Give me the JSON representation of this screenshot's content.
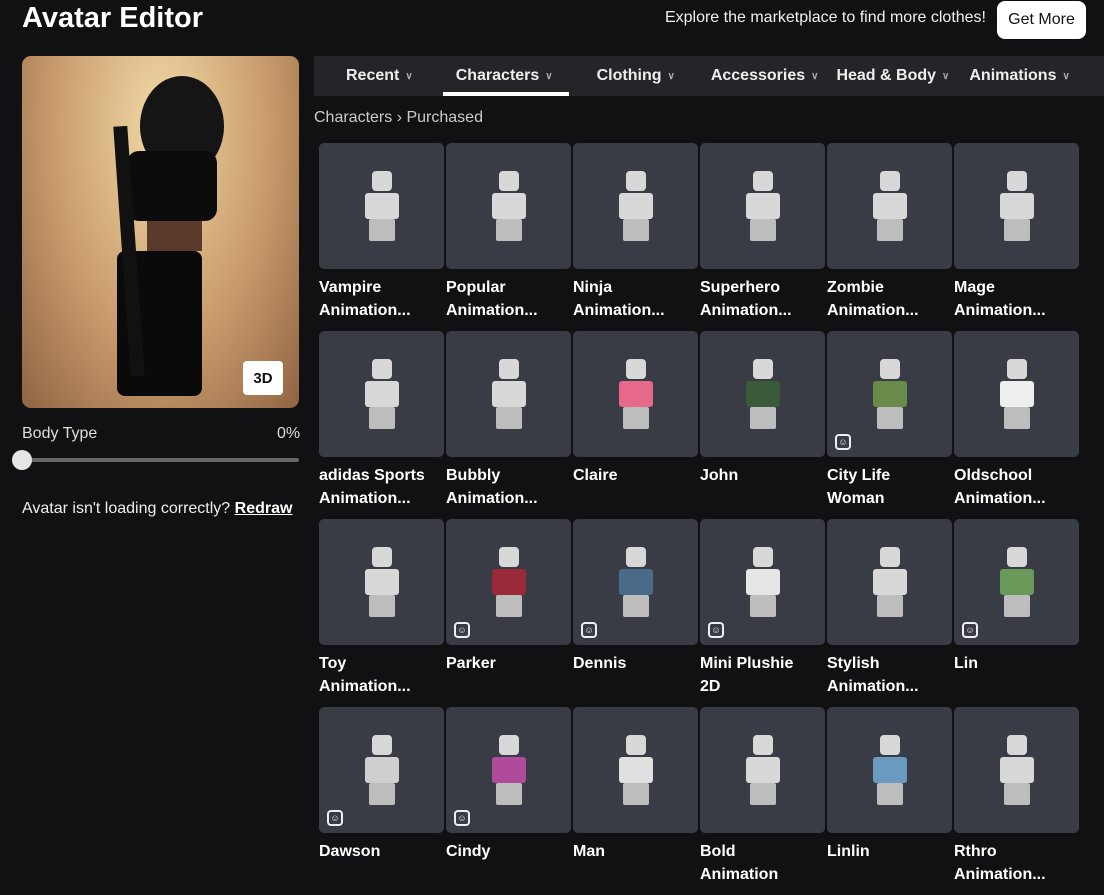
{
  "header": {
    "title": "Avatar Editor",
    "promo": "Explore the marketplace to find more clothes!",
    "get_more": "Get More"
  },
  "preview": {
    "view_toggle": "3D",
    "body_type_label": "Body Type",
    "body_type_value": "0%",
    "body_type_fraction": 0,
    "loading_text": "Avatar isn't loading correctly?",
    "redraw": "Redraw"
  },
  "nav": {
    "tabs": [
      {
        "label": "Recent"
      },
      {
        "label": "Characters",
        "active": true
      },
      {
        "label": "Clothing"
      },
      {
        "label": "Accessories"
      },
      {
        "label": "Head & Body"
      },
      {
        "label": "Animations"
      }
    ]
  },
  "breadcrumb": {
    "root": "Characters",
    "separator": "›",
    "current": "Purchased"
  },
  "items": [
    {
      "l1": "Vampire",
      "l2": "Animation...",
      "badge": false,
      "c": "#d8d8d8"
    },
    {
      "l1": "Popular",
      "l2": "Animation...",
      "badge": false,
      "c": "#d8d8d8"
    },
    {
      "l1": "Ninja",
      "l2": "Animation...",
      "badge": false,
      "c": "#d8d8d8"
    },
    {
      "l1": "Superhero",
      "l2": "Animation...",
      "badge": false,
      "c": "#d8d8d8"
    },
    {
      "l1": "Zombie",
      "l2": "Animation...",
      "badge": false,
      "c": "#d8d8d8"
    },
    {
      "l1": "Mage",
      "l2": "Animation...",
      "badge": false,
      "c": "#d8d8d8"
    },
    {
      "l1": "adidas Sports",
      "l2": "Animation...",
      "badge": false,
      "c": "#d8d8d8"
    },
    {
      "l1": "Bubbly",
      "l2": "Animation...",
      "badge": false,
      "c": "#d8d8d8"
    },
    {
      "l1": "Claire",
      "l2": "",
      "badge": false,
      "c": "#e86a8a"
    },
    {
      "l1": "John",
      "l2": "",
      "badge": false,
      "c": "#3a5a3a"
    },
    {
      "l1": "City Life",
      "l2": "Woman",
      "badge": true,
      "c": "#6a8a4a"
    },
    {
      "l1": "Oldschool",
      "l2": "Animation...",
      "badge": false,
      "c": "#eeeeee"
    },
    {
      "l1": "Toy",
      "l2": "Animation...",
      "badge": false,
      "c": "#d8d8d8"
    },
    {
      "l1": "Parker",
      "l2": "",
      "badge": true,
      "c": "#9a2a3a"
    },
    {
      "l1": "Dennis",
      "l2": "",
      "badge": true,
      "c": "#4a6a8a"
    },
    {
      "l1": "Mini Plushie",
      "l2": "2D",
      "badge": true,
      "c": "#e6e6e6"
    },
    {
      "l1": "Stylish",
      "l2": "Animation...",
      "badge": false,
      "c": "#d8d8d8"
    },
    {
      "l1": "Lin",
      "l2": "",
      "badge": true,
      "c": "#6a9a5a"
    },
    {
      "l1": "Dawson",
      "l2": "",
      "badge": true,
      "c": "#cfcfcf"
    },
    {
      "l1": "Cindy",
      "l2": "",
      "badge": true,
      "c": "#b04a9a"
    },
    {
      "l1": "Man",
      "l2": "",
      "badge": false,
      "c": "#e0e0e0"
    },
    {
      "l1": "Bold",
      "l2": "Animation",
      "badge": false,
      "c": "#d8d8d8"
    },
    {
      "l1": "Linlin",
      "l2": "",
      "badge": false,
      "c": "#6a9ac0"
    },
    {
      "l1": "Rthro",
      "l2": "Animation...",
      "badge": false,
      "c": "#d8d8d8"
    }
  ]
}
